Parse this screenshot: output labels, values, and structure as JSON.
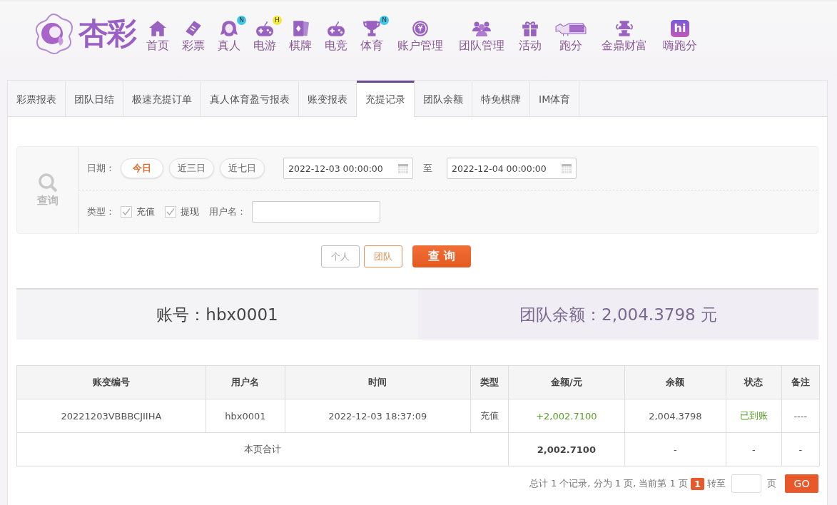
{
  "logo": {
    "text": "杏彩"
  },
  "nav": [
    {
      "label": "首页",
      "kind": "home"
    },
    {
      "label": "彩票",
      "kind": "ticket"
    },
    {
      "label": "真人",
      "kind": "figure",
      "badge": "N",
      "color": "#3ec8e8"
    },
    {
      "label": "电游",
      "kind": "gamepad",
      "badge": "H",
      "color": "#f2e83a"
    },
    {
      "label": "棋牌",
      "kind": "cards"
    },
    {
      "label": "电竞",
      "kind": "gamepad"
    },
    {
      "label": "体育",
      "kind": "trophy",
      "badge": "N",
      "color": "#3ec8e8"
    },
    {
      "label": "账户管理",
      "kind": "coin",
      "icon_text": "¥"
    },
    {
      "label": "团队管理",
      "kind": "people"
    },
    {
      "label": "活动",
      "kind": "gift"
    },
    {
      "label": "跑分",
      "kind": "rhino"
    },
    {
      "label": "金鼎财富",
      "kind": "urn"
    },
    {
      "label": "嗨跑分",
      "kind": "hi",
      "icon_text": "hi"
    }
  ],
  "tabs": [
    {
      "label": "彩票报表",
      "selected": false
    },
    {
      "label": "团队日结",
      "selected": false
    },
    {
      "label": "极速充提订单",
      "selected": false
    },
    {
      "label": "真人体育盈亏报表",
      "selected": false
    },
    {
      "label": "账变报表",
      "selected": false
    },
    {
      "label": "充提记录",
      "selected": true
    },
    {
      "label": "团队余额",
      "selected": false
    },
    {
      "label": "特免棋牌",
      "selected": false
    },
    {
      "label": "IM体育",
      "selected": false
    }
  ],
  "query": {
    "side_label": "查询",
    "date_label": "日期：",
    "quick_ranges": [
      {
        "label": "今日",
        "selected": true
      },
      {
        "label": "近三日",
        "selected": false
      },
      {
        "label": "近七日",
        "selected": false
      }
    ],
    "start": "2022-12-03 00:00:00",
    "to_label": "至",
    "end": "2022-12-04 00:00:00",
    "type_label": "类型：",
    "types": [
      {
        "label": "充值",
        "checked": true
      },
      {
        "label": "提现",
        "checked": true
      }
    ],
    "user_label": "用户名："
  },
  "scope": [
    {
      "label": "个人",
      "selected": false
    },
    {
      "label": "团队",
      "selected": true
    }
  ],
  "search_button": "查 询",
  "summary": {
    "account": "账号：hbx0001",
    "balance": "团队余额：2,004.3798 元"
  },
  "table": {
    "columns": [
      "账变编号",
      "用户名",
      "时间",
      "类型",
      "金额/元",
      "余额",
      "状态",
      "备注"
    ],
    "rows": [
      [
        {
          "text": "20221203VBBBCJIIHA"
        },
        {
          "text": "hbx0001"
        },
        {
          "text": "2022-12-03 18:37:09"
        },
        {
          "text": "充值"
        },
        {
          "text": "+2,002.7100",
          "kind": "positive"
        },
        {
          "text": "2,004.3798"
        },
        {
          "text": "已到账",
          "kind": "positive"
        },
        {
          "text": "----"
        }
      ]
    ],
    "total": {
      "label": "本页合计",
      "amount": "2,002.7100",
      "balance": "-",
      "status": "-",
      "note": "-"
    }
  },
  "pagination": {
    "summary": "总计 1 个记录, 分为 1 页, 当前第 1 页",
    "current": "1",
    "goto_label": "转至",
    "page_label": "页",
    "go_button": "GO"
  }
}
